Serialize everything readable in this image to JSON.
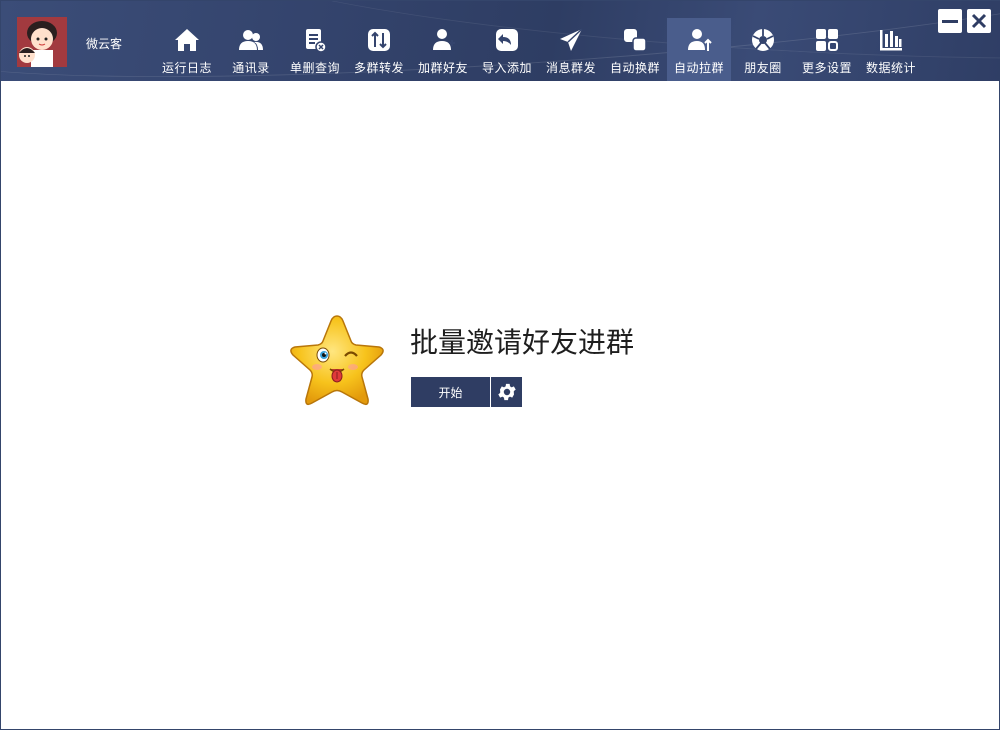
{
  "user": {
    "name": "微云客"
  },
  "nav": [
    {
      "label": "运行日志",
      "icon": "home-icon"
    },
    {
      "label": "通讯录",
      "icon": "contacts-icon"
    },
    {
      "label": "单删查询",
      "icon": "delete-check-icon"
    },
    {
      "label": "多群转发",
      "icon": "forward-icon"
    },
    {
      "label": "加群好友",
      "icon": "add-friend-icon"
    },
    {
      "label": "导入添加",
      "icon": "import-icon"
    },
    {
      "label": "消息群发",
      "icon": "send-icon"
    },
    {
      "label": "自动换群",
      "icon": "switch-group-icon"
    },
    {
      "label": "自动拉群",
      "icon": "pull-group-icon",
      "active": true
    },
    {
      "label": "朋友圈",
      "icon": "moments-icon"
    },
    {
      "label": "更多设置",
      "icon": "grid-icon"
    },
    {
      "label": "数据统计",
      "icon": "bar-chart-icon"
    }
  ],
  "main": {
    "title": "批量邀请好友进群",
    "start_label": "开始",
    "mascot_icon": "star-mascot-icon",
    "settings_icon": "gear-icon"
  },
  "colors": {
    "header": "#34446d",
    "active_tab": "#4a5d8c",
    "button": "#2f3d63",
    "star": "#f7c31c"
  }
}
